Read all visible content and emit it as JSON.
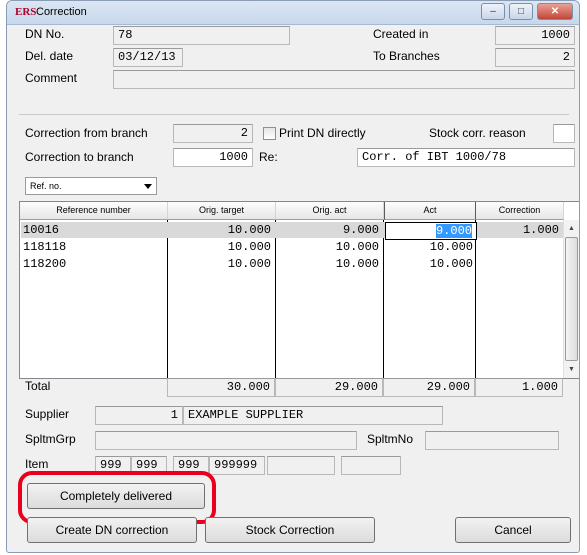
{
  "window": {
    "logo": "ERS",
    "title": "Correction",
    "controls": [
      "–",
      "□",
      "✕"
    ]
  },
  "header": {
    "dn_no_label": "DN No.",
    "dn_no_value": "78",
    "del_date_label": "Del. date",
    "del_date_value": "03/12/13",
    "comment_label": "Comment",
    "comment_value": "",
    "created_in_label": "Created in",
    "created_in_value": "1000",
    "to_branches_label": "To Branches",
    "to_branches_value": "2"
  },
  "correction": {
    "from_branch_label": "Correction from branch",
    "from_branch_value": "2",
    "print_dn_label": "Print DN directly",
    "print_dn_checked": false,
    "stock_reason_label": "Stock corr. reason",
    "stock_reason_value": "",
    "to_branch_label": "Correction to branch",
    "to_branch_value": "1000",
    "re_label": "Re:",
    "re_value": "Corr. of IBT 1000/78"
  },
  "ref_combo": {
    "selected": "Ref. no."
  },
  "grid": {
    "columns": [
      "Reference number",
      "Orig. target",
      "Orig. act",
      "Act",
      "Correction"
    ],
    "rows": [
      {
        "ref": "10016",
        "orig_target": "10.000",
        "orig_act": "9.000",
        "act": "9.000",
        "correction": "1.000"
      },
      {
        "ref": "118118",
        "orig_target": "10.000",
        "orig_act": "10.000",
        "act": "10.000",
        "correction": ""
      },
      {
        "ref": "118200",
        "orig_target": "10.000",
        "orig_act": "10.000",
        "act": "10.000",
        "correction": ""
      }
    ],
    "selected_row": 0
  },
  "totals": {
    "label": "Total",
    "orig_target": "30.000",
    "orig_act": "29.000",
    "act": "29.000",
    "correction": "1.000"
  },
  "supplier": {
    "supplier_label": "Supplier",
    "supplier_no": "1",
    "supplier_name": "EXAMPLE SUPPLIER",
    "spltmgrp_label": "SpltmGrp",
    "spltmgrp_value": "",
    "spltmno_label": "SpltmNo",
    "spltmno_value": "",
    "item_label": "Item",
    "item_parts": [
      "999",
      "999",
      "999",
      "999999",
      "",
      ""
    ]
  },
  "buttons": {
    "completely_delivered": "Completely delivered",
    "create_dn_correction": "Create DN correction",
    "stock_correction": "Stock Correction",
    "cancel": "Cancel"
  },
  "colors": {
    "highlight": "#e8001c",
    "selection": "#3399ff",
    "logo": "#b3002d"
  }
}
